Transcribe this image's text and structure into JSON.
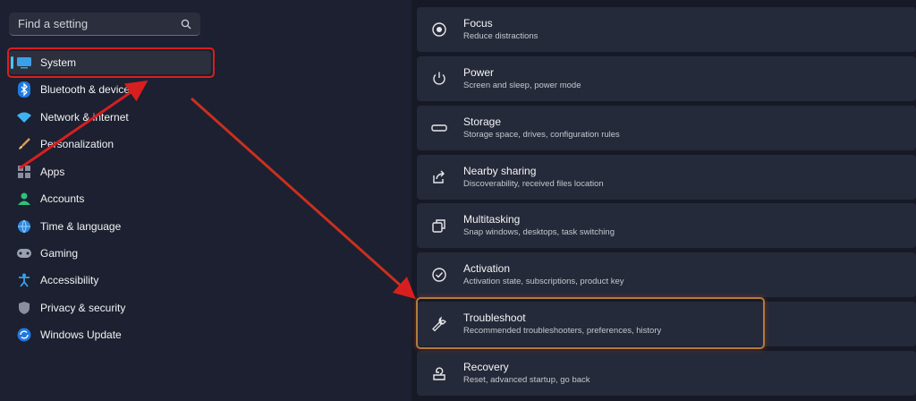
{
  "search": {
    "placeholder": "Find a setting",
    "icon": "search-icon"
  },
  "sidebar": {
    "items": [
      {
        "label": "System",
        "icon": "monitor-icon",
        "selected": true
      },
      {
        "label": "Bluetooth & devices",
        "icon": "bluetooth-icon"
      },
      {
        "label": "Network & internet",
        "icon": "wifi-icon"
      },
      {
        "label": "Personalization",
        "icon": "brush-icon"
      },
      {
        "label": "Apps",
        "icon": "apps-icon"
      },
      {
        "label": "Accounts",
        "icon": "person-icon"
      },
      {
        "label": "Time & language",
        "icon": "globe-clock-icon"
      },
      {
        "label": "Gaming",
        "icon": "gamepad-icon"
      },
      {
        "label": "Accessibility",
        "icon": "accessibility-icon"
      },
      {
        "label": "Privacy & security",
        "icon": "shield-icon"
      },
      {
        "label": "Windows Update",
        "icon": "update-icon"
      }
    ]
  },
  "settings": {
    "cards": [
      {
        "title": "Focus",
        "subtitle": "Reduce distractions",
        "icon": "focus-icon"
      },
      {
        "title": "Power",
        "subtitle": "Screen and sleep, power mode",
        "icon": "power-icon"
      },
      {
        "title": "Storage",
        "subtitle": "Storage space, drives, configuration rules",
        "icon": "storage-icon"
      },
      {
        "title": "Nearby sharing",
        "subtitle": "Discoverability, received files location",
        "icon": "share-icon"
      },
      {
        "title": "Multitasking",
        "subtitle": "Snap windows, desktops, task switching",
        "icon": "multitask-icon"
      },
      {
        "title": "Activation",
        "subtitle": "Activation state, subscriptions, product key",
        "icon": "check-circle-icon"
      },
      {
        "title": "Troubleshoot",
        "subtitle": "Recommended troubleshooters, preferences, history",
        "icon": "wrench-icon"
      },
      {
        "title": "Recovery",
        "subtitle": "Reset, advanced startup, go back",
        "icon": "recovery-icon"
      }
    ]
  },
  "colors": {
    "accent": "#4cc2ff",
    "annotation": "#d71f1f",
    "highlight_outline": "#b07c3e"
  }
}
